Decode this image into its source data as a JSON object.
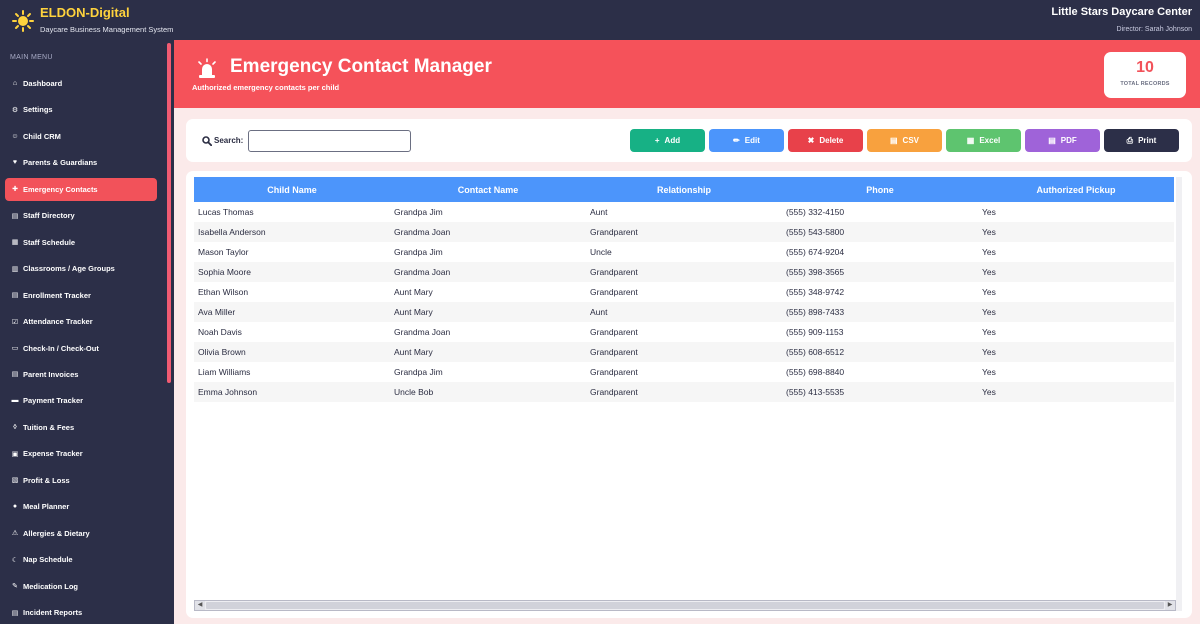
{
  "topbar": {
    "brand_name": "ELDON-Digital",
    "brand_sub": "Daycare Business Management System",
    "center_name": "Little Stars Daycare Center",
    "director": "Director: Sarah Johnson"
  },
  "sidebar": {
    "heading": "MAIN MENU",
    "items": [
      {
        "label": "Dashboard",
        "icon": "⌂"
      },
      {
        "label": "Settings",
        "icon": "⚙"
      },
      {
        "label": "Child CRM",
        "icon": "☺"
      },
      {
        "label": "Parents & Guardians",
        "icon": "♥"
      },
      {
        "label": "Emergency Contacts",
        "icon": "✚"
      },
      {
        "label": "Staff Directory",
        "icon": "▤"
      },
      {
        "label": "Staff Schedule",
        "icon": "▦"
      },
      {
        "label": "Classrooms / Age Groups",
        "icon": "▥"
      },
      {
        "label": "Enrollment Tracker",
        "icon": "▤"
      },
      {
        "label": "Attendance Tracker",
        "icon": "☑"
      },
      {
        "label": "Check-In / Check-Out",
        "icon": "▭"
      },
      {
        "label": "Parent Invoices",
        "icon": "▤"
      },
      {
        "label": "Payment Tracker",
        "icon": "▬"
      },
      {
        "label": "Tuition & Fees",
        "icon": "◊"
      },
      {
        "label": "Expense Tracker",
        "icon": "▣"
      },
      {
        "label": "Profit & Loss",
        "icon": "▧"
      },
      {
        "label": "Meal Planner",
        "icon": "●"
      },
      {
        "label": "Allergies & Dietary",
        "icon": "⚠"
      },
      {
        "label": "Nap Schedule",
        "icon": "☾"
      },
      {
        "label": "Medication Log",
        "icon": "✎"
      },
      {
        "label": "Incident Reports",
        "icon": "▤"
      }
    ],
    "active_index": 4,
    "active_color": "#f2525a"
  },
  "header": {
    "title": "Emergency Contact Manager",
    "subtitle": "Authorized emergency contacts per child",
    "records_count": "10",
    "records_label": "TOTAL RECORDS",
    "icon": "siren-icon"
  },
  "toolbar": {
    "search_label": "Search:",
    "search_value": "",
    "buttons": [
      {
        "label": "Add",
        "icon": "+",
        "color": "#17b185"
      },
      {
        "label": "Edit",
        "icon": "✏",
        "color": "#4c95fb"
      },
      {
        "label": "Delete",
        "icon": "✖",
        "color": "#e8414a"
      },
      {
        "label": "CSV",
        "icon": "▤",
        "color": "#f8a13e"
      },
      {
        "label": "Excel",
        "icon": "▦",
        "color": "#5ec46f"
      },
      {
        "label": "PDF",
        "icon": "▤",
        "color": "#9f63d9"
      },
      {
        "label": "Print",
        "icon": "⎙",
        "color": "#2c2f48"
      }
    ]
  },
  "table": {
    "columns": [
      "Child Name",
      "Contact Name",
      "Relationship",
      "Phone",
      "Authorized Pickup"
    ],
    "rows": [
      [
        "Lucas Thomas",
        "Grandpa Jim",
        "Aunt",
        "(555) 332-4150",
        "Yes"
      ],
      [
        "Isabella Anderson",
        "Grandma Joan",
        "Grandparent",
        "(555) 543-5800",
        "Yes"
      ],
      [
        "Mason Taylor",
        "Grandpa Jim",
        "Uncle",
        "(555) 674-9204",
        "Yes"
      ],
      [
        "Sophia Moore",
        "Grandma Joan",
        "Grandparent",
        "(555) 398-3565",
        "Yes"
      ],
      [
        "Ethan Wilson",
        "Aunt Mary",
        "Grandparent",
        "(555) 348-9742",
        "Yes"
      ],
      [
        "Ava Miller",
        "Aunt Mary",
        "Aunt",
        "(555) 898-7433",
        "Yes"
      ],
      [
        "Noah Davis",
        "Grandma Joan",
        "Grandparent",
        "(555) 909-1153",
        "Yes"
      ],
      [
        "Olivia Brown",
        "Aunt Mary",
        "Grandparent",
        "(555) 608-6512",
        "Yes"
      ],
      [
        "Liam Williams",
        "Grandpa Jim",
        "Grandparent",
        "(555) 698-8840",
        "Yes"
      ],
      [
        "Emma Johnson",
        "Uncle Bob",
        "Grandparent",
        "(555) 413-5535",
        "Yes"
      ]
    ]
  }
}
